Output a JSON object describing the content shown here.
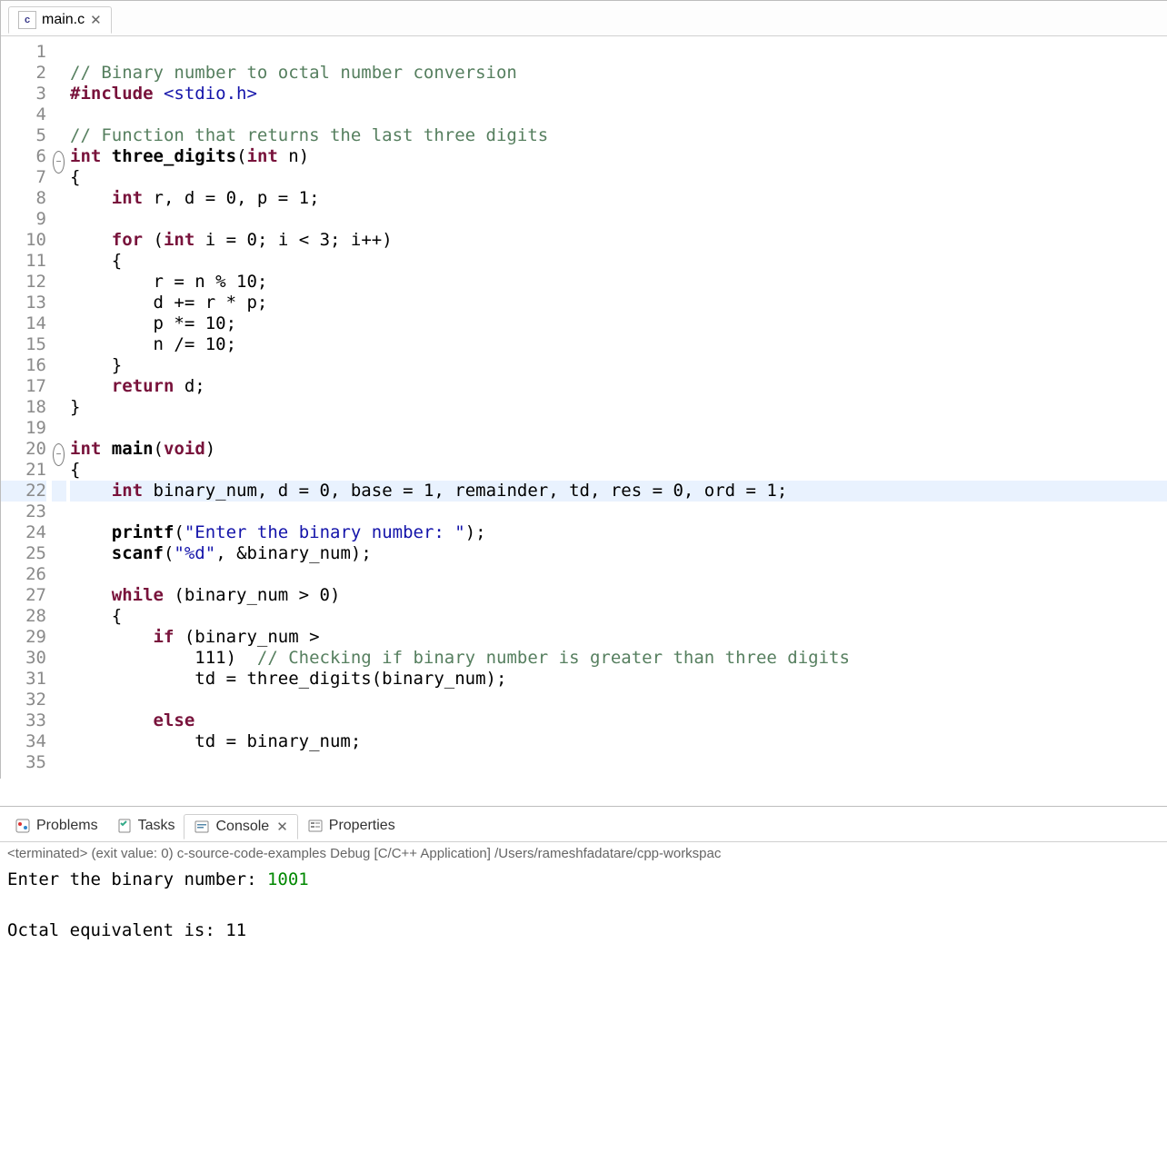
{
  "tab": {
    "filename": "main.c",
    "icon_letter": "c"
  },
  "fold_markers": {
    "6": "−",
    "20": "−"
  },
  "cursor_line_index": 21,
  "lines": [
    {
      "n": 1,
      "tokens": []
    },
    {
      "n": 2,
      "tokens": [
        {
          "c": "cmt",
          "t": "// Binary number to octal number conversion"
        }
      ]
    },
    {
      "n": 3,
      "tokens": [
        {
          "c": "pp",
          "t": "#include"
        },
        {
          "t": " "
        },
        {
          "c": "incfile",
          "t": "<stdio.h>"
        }
      ]
    },
    {
      "n": 4,
      "tokens": []
    },
    {
      "n": 5,
      "tokens": [
        {
          "c": "cmt",
          "t": "// Function that returns the last three digits"
        }
      ]
    },
    {
      "n": 6,
      "tokens": [
        {
          "c": "type",
          "t": "int"
        },
        {
          "t": " "
        },
        {
          "c": "fn",
          "t": "three_digits"
        },
        {
          "t": "("
        },
        {
          "c": "type",
          "t": "int"
        },
        {
          "t": " n)"
        }
      ]
    },
    {
      "n": 7,
      "tokens": [
        {
          "t": "{"
        }
      ]
    },
    {
      "n": 8,
      "tokens": [
        {
          "t": "    "
        },
        {
          "c": "type",
          "t": "int"
        },
        {
          "t": " r, d = 0, p = 1;"
        }
      ]
    },
    {
      "n": 9,
      "tokens": []
    },
    {
      "n": 10,
      "tokens": [
        {
          "t": "    "
        },
        {
          "c": "kw",
          "t": "for"
        },
        {
          "t": " ("
        },
        {
          "c": "type",
          "t": "int"
        },
        {
          "t": " i = 0; i < 3; i++)"
        }
      ]
    },
    {
      "n": 11,
      "tokens": [
        {
          "t": "    {"
        }
      ]
    },
    {
      "n": 12,
      "tokens": [
        {
          "t": "        r = n % 10;"
        }
      ]
    },
    {
      "n": 13,
      "tokens": [
        {
          "t": "        d += r * p;"
        }
      ]
    },
    {
      "n": 14,
      "tokens": [
        {
          "t": "        p *= 10;"
        }
      ]
    },
    {
      "n": 15,
      "tokens": [
        {
          "t": "        n /= 10;"
        }
      ]
    },
    {
      "n": 16,
      "tokens": [
        {
          "t": "    }"
        }
      ]
    },
    {
      "n": 17,
      "tokens": [
        {
          "t": "    "
        },
        {
          "c": "kw",
          "t": "return"
        },
        {
          "t": " d;"
        }
      ]
    },
    {
      "n": 18,
      "tokens": [
        {
          "t": "}"
        }
      ]
    },
    {
      "n": 19,
      "tokens": []
    },
    {
      "n": 20,
      "tokens": [
        {
          "c": "type",
          "t": "int"
        },
        {
          "t": " "
        },
        {
          "c": "fn",
          "t": "main"
        },
        {
          "t": "("
        },
        {
          "c": "type",
          "t": "void"
        },
        {
          "t": ")"
        }
      ]
    },
    {
      "n": 21,
      "tokens": [
        {
          "t": "{"
        }
      ]
    },
    {
      "n": 22,
      "tokens": [
        {
          "t": "    "
        },
        {
          "c": "type",
          "t": "int"
        },
        {
          "t": " binary_num, d = 0, base = 1, remainder, td, res = 0, ord = 1;"
        }
      ]
    },
    {
      "n": 23,
      "tokens": []
    },
    {
      "n": 24,
      "tokens": [
        {
          "t": "    "
        },
        {
          "c": "fn",
          "t": "printf"
        },
        {
          "t": "("
        },
        {
          "c": "str",
          "t": "\"Enter the binary number: \""
        },
        {
          "t": ");"
        }
      ]
    },
    {
      "n": 25,
      "tokens": [
        {
          "t": "    "
        },
        {
          "c": "fn",
          "t": "scanf"
        },
        {
          "t": "("
        },
        {
          "c": "str",
          "t": "\"%d\""
        },
        {
          "t": ", &binary_num);"
        }
      ]
    },
    {
      "n": 26,
      "tokens": []
    },
    {
      "n": 27,
      "tokens": [
        {
          "t": "    "
        },
        {
          "c": "kw",
          "t": "while"
        },
        {
          "t": " (binary_num > 0)"
        }
      ]
    },
    {
      "n": 28,
      "tokens": [
        {
          "t": "    {"
        }
      ]
    },
    {
      "n": 29,
      "tokens": [
        {
          "t": "        "
        },
        {
          "c": "kw",
          "t": "if"
        },
        {
          "t": " (binary_num >"
        }
      ]
    },
    {
      "n": 30,
      "tokens": [
        {
          "t": "            111)  "
        },
        {
          "c": "cmt",
          "t": "// Checking if binary number is greater than three digits"
        }
      ]
    },
    {
      "n": 31,
      "tokens": [
        {
          "t": "            td = three_digits(binary_num);"
        }
      ]
    },
    {
      "n": 32,
      "tokens": []
    },
    {
      "n": 33,
      "tokens": [
        {
          "t": "        "
        },
        {
          "c": "kw",
          "t": "else"
        }
      ]
    },
    {
      "n": 34,
      "tokens": [
        {
          "t": "            td = binary_num;"
        }
      ]
    },
    {
      "n": 35,
      "tokens": []
    }
  ],
  "panel": {
    "tabs": [
      {
        "id": "problems",
        "label": "Problems"
      },
      {
        "id": "tasks",
        "label": "Tasks"
      },
      {
        "id": "console",
        "label": "Console"
      },
      {
        "id": "properties",
        "label": "Properties"
      }
    ],
    "active_tab": "console",
    "console_desc": "<terminated> (exit value: 0) c-source-code-examples Debug [C/C++ Application] /Users/rameshfadatare/cpp-workspac",
    "output": {
      "line1_prompt": "Enter the binary number: ",
      "line1_input": "1001",
      "line2": "",
      "line3": "Octal equivalent is: 11"
    }
  },
  "cut_label": "a"
}
